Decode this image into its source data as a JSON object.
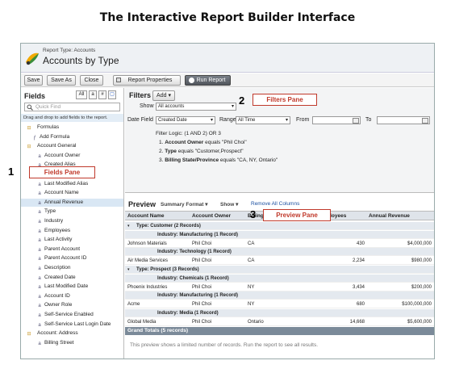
{
  "page_title": "The Interactive Report Builder Interface",
  "header": {
    "report_type_label": "Report Type: Accounts",
    "report_title": "Accounts by Type"
  },
  "toolbar": {
    "save": "Save",
    "save_as": "Save As",
    "close": "Close",
    "report_properties": "Report Properties",
    "run_report": "Run Report"
  },
  "fields_pane": {
    "title": "Fields",
    "seg_all": "All",
    "seg_a": "a",
    "seg_hash": "#",
    "search_placeholder": "Quick Find",
    "hint": "Drag and drop to add fields to the report.",
    "items": [
      "Formulas",
      "Add Formula",
      "Account General",
      "Account Owner",
      "Created Alias",
      "Last Modified By",
      "Last Modified Alias",
      "Account Name",
      "Annual Revenue",
      "Type",
      "Industry",
      "Employees",
      "Last Activity",
      "Parent Account",
      "Parent Account ID",
      "Description",
      "Created Date",
      "Last Modified Date",
      "Account ID",
      "Owner Role",
      "Self-Service Enabled",
      "Self-Service Last Login Date",
      "Account: Address",
      "Billing Street"
    ]
  },
  "filters": {
    "title": "Filters",
    "add": "Add",
    "show_label": "Show",
    "show_value": "All accounts",
    "date_field_label": "Date Field",
    "date_field_value": "Created Date",
    "range_label": "Range",
    "range_value": "All Time",
    "from_label": "From",
    "to_label": "To",
    "logic": "Filter Logic: (1 AND 2) OR 3",
    "f1_prefix": "1.",
    "f1_field": "Account Owner",
    "f1_rest": "equals \"Phil Choi\"",
    "f2_prefix": "2.",
    "f2_field": "Type",
    "f2_rest": "equals \"Customer,Prospect\"",
    "f3_prefix": "3.",
    "f3_field": "Billing State/Province",
    "f3_rest": "equals \"CA, NY, Ontario\""
  },
  "preview": {
    "title": "Preview",
    "format": "Summary Format",
    "show": "Show",
    "remove": "Remove All Columns",
    "columns": [
      "Account Name",
      "Account Owner",
      "Billing State/Province",
      "Employees",
      "Annual Revenue"
    ],
    "rows": [
      {
        "kind": "type",
        "text": "Type: Customer (2 Records)"
      },
      {
        "kind": "ind",
        "text": "Industry: Manufacturing (1 Record)"
      },
      {
        "kind": "data",
        "cells": [
          "Johnson Materials",
          "Phil Choi",
          "CA",
          "430",
          "$4,000,000"
        ]
      },
      {
        "kind": "ind",
        "text": "Industry: Technology (1 Record)"
      },
      {
        "kind": "data",
        "cells": [
          "Air Media Services",
          "Phil Choi",
          "CA",
          "2,234",
          "$980,000"
        ]
      },
      {
        "kind": "type",
        "text": "Type: Prospect (3 Records)"
      },
      {
        "kind": "ind",
        "text": "Industry: Chemicals (1 Record)"
      },
      {
        "kind": "data",
        "cells": [
          "Phoenix Industries",
          "Phil Choi",
          "NY",
          "3,434",
          "$200,000"
        ]
      },
      {
        "kind": "ind",
        "text": "Industry: Manufacturing (1 Record)"
      },
      {
        "kind": "data",
        "cells": [
          "Acme",
          "Phil Choi",
          "NY",
          "680",
          "$100,000,000"
        ]
      },
      {
        "kind": "ind",
        "text": "Industry: Media (1 Record)"
      },
      {
        "kind": "data",
        "cells": [
          "Global Media",
          "Phil Choi",
          "Ontario",
          "14,668",
          "$5,600,000"
        ]
      }
    ],
    "grand_totals": "Grand Totals (5 records)",
    "footer": "This preview shows a limited number of records. Run the report to see all results."
  },
  "callouts": {
    "n1": "1",
    "fields_pane": "Fields Pane",
    "n2": "2",
    "filters_pane": "Filters Pane",
    "n3": "3",
    "preview_pane": "Preview Pane"
  }
}
